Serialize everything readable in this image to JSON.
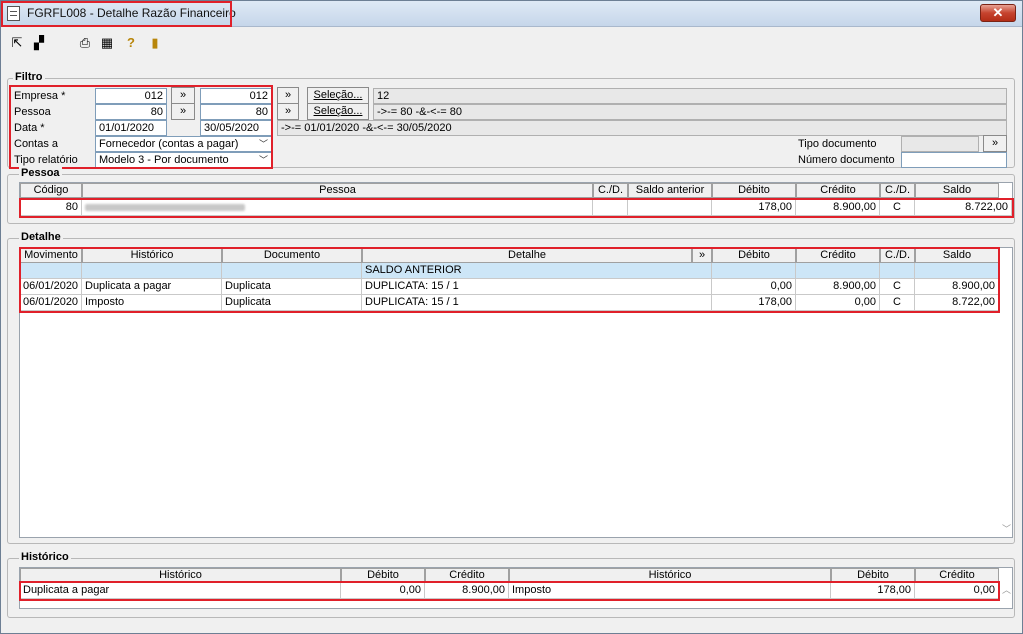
{
  "window": {
    "title": "FGRFL008 - Detalhe Razão Financeiro",
    "close_label": "✕"
  },
  "toolbar": {
    "icons": [
      "first-icon",
      "navigate-icon",
      "print-icon",
      "grid-icon",
      "help-icon",
      "exit-icon"
    ]
  },
  "filtro": {
    "label": "Filtro",
    "empresa": {
      "label": "Empresa *",
      "from": "012",
      "to": "012",
      "jump": "»",
      "select": "Seleção...",
      "summary": "12"
    },
    "pessoa": {
      "label": "Pessoa",
      "from": "80",
      "to": "80",
      "jump": "»",
      "select": "Seleção...",
      "summary": "->-= 80 -&-<-= 80"
    },
    "data": {
      "label": "Data *",
      "from": "01/01/2020",
      "to": "30/05/2020",
      "summary": "->-= 01/01/2020 -&-<-= 30/05/2020"
    },
    "contas": {
      "label": "Contas a",
      "value": "Fornecedor (contas a pagar)"
    },
    "tipo_relatorio": {
      "label": "Tipo relatório",
      "value": "Modelo 3 - Por documento"
    },
    "tipo_documento": {
      "label": "Tipo documento",
      "value": "",
      "jump": "»"
    },
    "numero_documento": {
      "label": "Número documento",
      "value": ""
    }
  },
  "pessoa_grid": {
    "label": "Pessoa",
    "headers": [
      "Código",
      "Pessoa",
      "C./D.",
      "Saldo anterior",
      "Débito",
      "Crédito",
      "C./D.",
      "Saldo"
    ],
    "row": {
      "codigo": "80",
      "pessoa": "",
      "cd1": "",
      "saldo_anterior": "",
      "debito": "178,00",
      "credito": "8.900,00",
      "cd2": "C",
      "saldo": "8.722,00"
    }
  },
  "detalhe_grid": {
    "label": "Detalhe",
    "headers": [
      "Movimento",
      "Histórico",
      "Documento",
      "Detalhe",
      "»",
      "Débito",
      "Crédito",
      "C./D.",
      "Saldo"
    ],
    "saldo_anterior_label": "SALDO ANTERIOR",
    "rows": [
      {
        "movimento": "06/01/2020",
        "historico": "Duplicata a pagar",
        "documento": "Duplicata",
        "detalhe": "DUPLICATA: 15 / 1",
        "debito": "0,00",
        "credito": "8.900,00",
        "cd": "C",
        "saldo": "8.900,00"
      },
      {
        "movimento": "06/01/2020",
        "historico": "Imposto",
        "documento": "Duplicata",
        "detalhe": "DUPLICATA: 15 / 1",
        "debito": "178,00",
        "credito": "0,00",
        "cd": "C",
        "saldo": "8.722,00"
      }
    ]
  },
  "historico_grid": {
    "label": "Histórico",
    "headers": [
      "Histórico",
      "Débito",
      "Crédito",
      "Histórico",
      "Débito",
      "Crédito"
    ],
    "row": {
      "historico1": "Duplicata a pagar",
      "debito1": "0,00",
      "credito1": "8.900,00",
      "historico2": "Imposto",
      "debito2": "178,00",
      "credito2": "0,00"
    }
  },
  "colors": {
    "highlight": "#e0202a",
    "selected_row": "#cde6f7"
  }
}
